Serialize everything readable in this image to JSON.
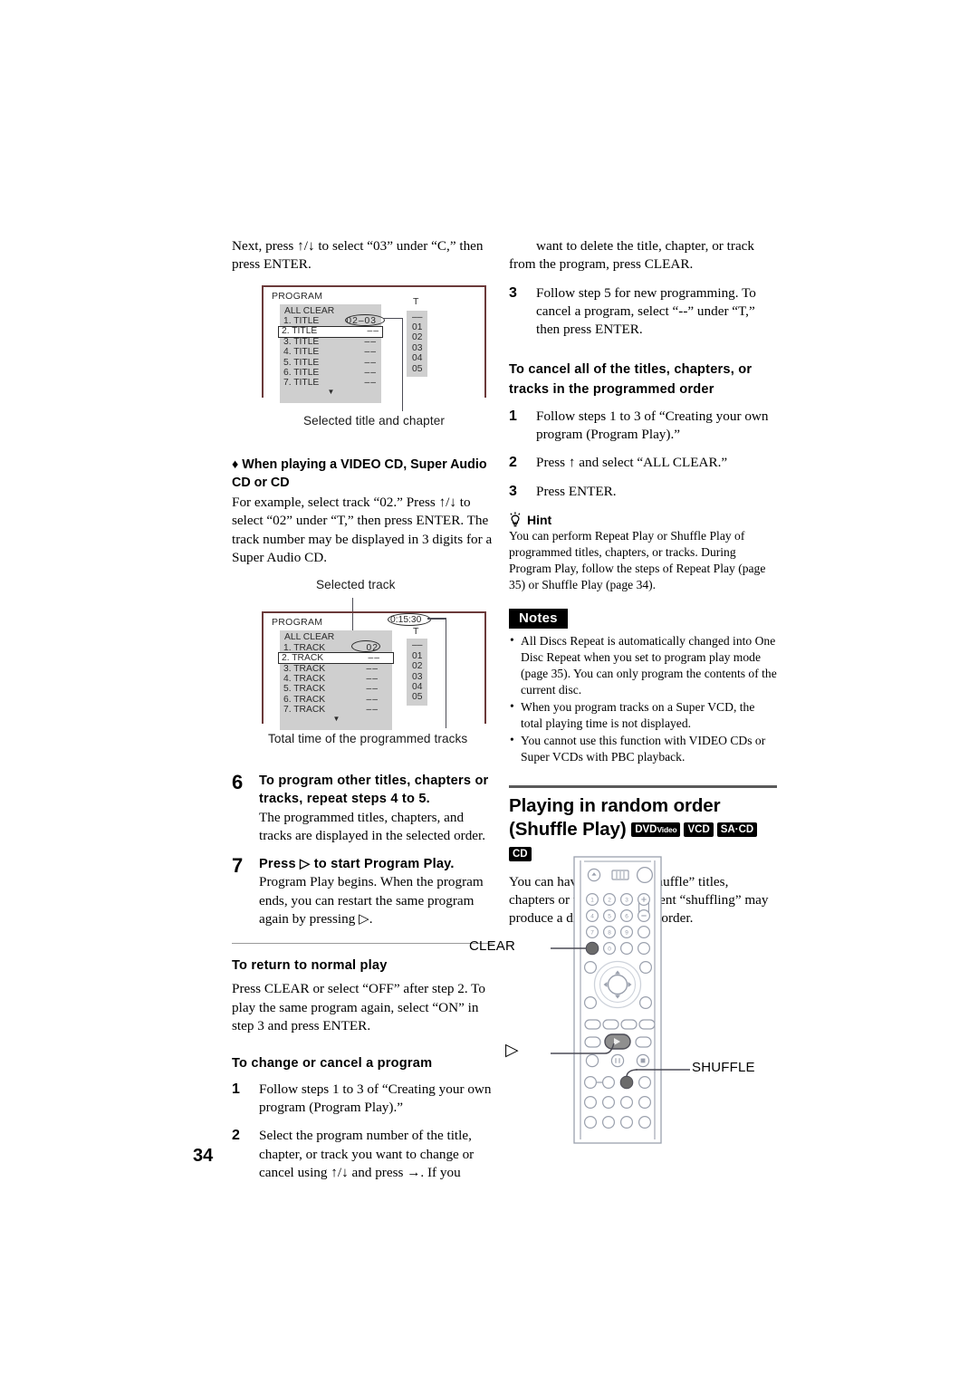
{
  "page": {
    "number": "34"
  },
  "left": {
    "intro": "Next, press ↑/↓ to select “03” under “C,” then press ENTER.",
    "diagram1": {
      "screen_title": "PROGRAM",
      "all_clear": "ALL CLEAR",
      "rows": [
        {
          "label": "1. TITLE",
          "value": "02–03"
        },
        {
          "label": "2. TITLE",
          "value": "––"
        },
        {
          "label": "3. TITLE",
          "value": "––"
        },
        {
          "label": "4. TITLE",
          "value": "––"
        },
        {
          "label": "5. TITLE",
          "value": "––"
        },
        {
          "label": "6. TITLE",
          "value": "––"
        },
        {
          "label": "7. TITLE",
          "value": "––"
        }
      ],
      "selected_row": {
        "label": "2. TITLE",
        "value": "––"
      },
      "t_label": "T",
      "t_values": [
        "––",
        "01",
        "02",
        "03",
        "04",
        "05"
      ],
      "caption": "Selected title and chapter",
      "scroll_caret": "▼"
    },
    "vcd_head": "♦ When playing a VIDEO CD, Super Audio CD or CD",
    "vcd_body": "For example, select track “02.” Press ↑/↓ to select “02” under “T,” then press ENTER. The track number may be displayed in 3 digits for a Super Audio CD.",
    "diagram2": {
      "caption_top": "Selected track",
      "screen_title": "PROGRAM",
      "time_value": "0:15:30",
      "all_clear": "ALL CLEAR",
      "rows": [
        {
          "label": "1. TRACK",
          "value": "02"
        },
        {
          "label": "2. TRACK",
          "value": "––"
        },
        {
          "label": "3. TRACK",
          "value": "––"
        },
        {
          "label": "4. TRACK",
          "value": "––"
        },
        {
          "label": "5. TRACK",
          "value": "––"
        },
        {
          "label": "6. TRACK",
          "value": "––"
        },
        {
          "label": "7. TRACK",
          "value": "––"
        }
      ],
      "selected_row": {
        "label": "2. TRACK",
        "value": "––"
      },
      "t_label": "T",
      "t_values": [
        "––",
        "01",
        "02",
        "03",
        "04",
        "05"
      ],
      "caption_bottom": "Total time of the programmed tracks",
      "scroll_caret": "▼"
    },
    "step6": {
      "num": "6",
      "bold": "To program other titles, chapters or tracks, repeat steps 4 to 5.",
      "body": "The programmed titles, chapters, and tracks are displayed in the selected order."
    },
    "step7": {
      "num": "7",
      "bold": "Press ▷ to start Program Play.",
      "body": "Program Play begins. When the program ends, you can restart the same program again by pressing ▷."
    },
    "return_head": "To return to normal play",
    "return_body": "Press CLEAR or select “OFF” after step 2. To play the same program again, select “ON” in step 3 and press ENTER.",
    "change_head": "To change or cancel a program",
    "change_steps": [
      {
        "num": "1",
        "text": "Follow steps 1 to 3 of “Creating your own program (Program Play).”"
      },
      {
        "num": "2",
        "text": "Select the program number of the title, chapter, or track you want to change or cancel using ↑/↓ and press →. If you"
      }
    ]
  },
  "right": {
    "cont_text": "want to delete the title, chapter, or track from the program, press CLEAR.",
    "step3": {
      "num": "3",
      "text": "Follow step 5 for new programming. To cancel a program, select “--” under “T,” then press ENTER."
    },
    "cancel_head": "To cancel all of the titles, chapters, or tracks in the programmed order",
    "cancel_steps": [
      {
        "num": "1",
        "text": "Follow steps 1 to 3 of “Creating your own program (Program Play).”"
      },
      {
        "num": "2",
        "text": "Press ↑ and select “ALL CLEAR.”"
      },
      {
        "num": "3",
        "text": "Press ENTER."
      }
    ],
    "hint_label": "Hint",
    "hint_icon": "lightbulb-icon",
    "hint_body": "You can perform Repeat Play or Shuffle Play of programmed titles, chapters, or tracks. During Program Play, follow the steps of Repeat Play (page 35) or Shuffle Play (page 34).",
    "notes_label": "Notes",
    "notes": [
      "All Discs Repeat is automatically changed into One Disc Repeat when you set to program play mode (page 35). You can only program the contents of the current disc.",
      "When you program tracks on a Super VCD, the total playing time is not displayed.",
      "You cannot use this function with VIDEO CDs or Super VCDs with PBC playback."
    ],
    "section_title": "Playing in random order (Shuffle Play)",
    "disc_icons": [
      {
        "main": "DVD",
        "sub": "Video"
      },
      {
        "main": "VCD",
        "sub": ""
      },
      {
        "main": "SA·CD",
        "sub": ""
      },
      {
        "main": "CD",
        "sub": ""
      }
    ],
    "section_body": "You can have the player “shuffle” titles, chapters or tracks. Subsequent “shuffling” may produce a different playing order.",
    "remote": {
      "clear_label": "CLEAR",
      "play_label": "▷",
      "shuffle_label": "SHUFFLE",
      "numbers": [
        "1",
        "2",
        "3",
        "4",
        "5",
        "6",
        "7",
        "8",
        "9",
        "0"
      ]
    }
  }
}
